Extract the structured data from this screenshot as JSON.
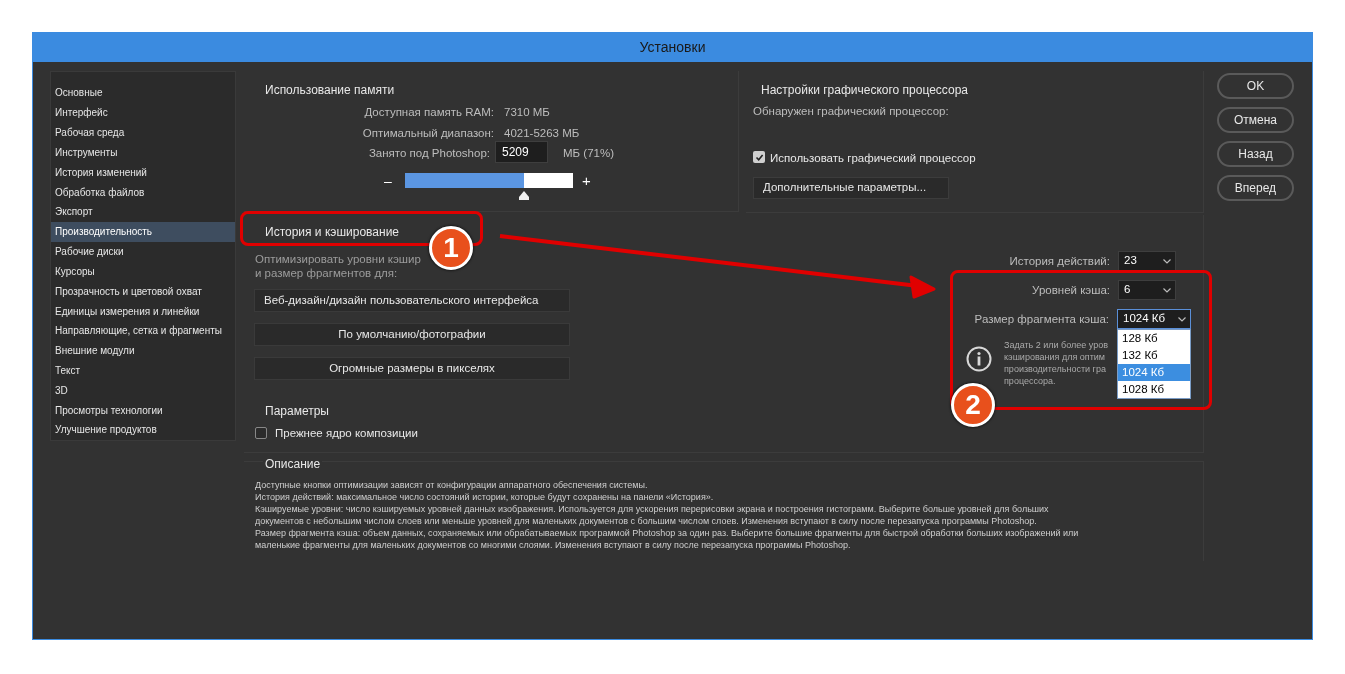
{
  "window": {
    "title": "Установки"
  },
  "sidebar": {
    "items": [
      {
        "label": "Основные",
        "selected": false
      },
      {
        "label": "Интерфейс",
        "selected": false
      },
      {
        "label": "Рабочая среда",
        "selected": false
      },
      {
        "label": "Инструменты",
        "selected": false
      },
      {
        "label": "История изменений",
        "selected": false
      },
      {
        "label": "Обработка файлов",
        "selected": false
      },
      {
        "label": "Экспорт",
        "selected": false
      },
      {
        "label": "Производительность",
        "selected": true
      },
      {
        "label": "Рабочие диски",
        "selected": false
      },
      {
        "label": "Курсоры",
        "selected": false
      },
      {
        "label": "Прозрачность и цветовой охват",
        "selected": false
      },
      {
        "label": "Единицы измерения и линейки",
        "selected": false
      },
      {
        "label": "Направляющие, сетка и фрагменты",
        "selected": false
      },
      {
        "label": "Внешние модули",
        "selected": false
      },
      {
        "label": "Текст",
        "selected": false
      },
      {
        "label": "3D",
        "selected": false
      },
      {
        "label": "Просмотры технологии",
        "selected": false
      },
      {
        "label": "Улучшение продуктов",
        "selected": false
      }
    ]
  },
  "memory": {
    "title": "Использование памяти",
    "rows": [
      {
        "label": "Доступная память RAM:",
        "value": "7310 МБ"
      },
      {
        "label": "Оптимальный диапазон:",
        "value": "4021-5263 МБ"
      }
    ],
    "field": {
      "label": "Занято под Photoshop:",
      "value": "5209",
      "unit": "МБ (71%)"
    },
    "slider": {
      "minus": "–",
      "plus": "+",
      "level": 0.71
    }
  },
  "gpu": {
    "title": "Настройки графического процессора",
    "detected": "Обнаружен графический процессор:",
    "use_gpu": {
      "label": "Использовать графический процессор",
      "checked": true
    },
    "advanced_button": "Дополнительные параметры..."
  },
  "history": {
    "title": "История и кэширование",
    "optimize_lines": [
      "Оптимизировать уровни кэшир",
      "и размер фрагментов для:"
    ],
    "presets": [
      "Веб-дизайн/дизайн пользовательского интерфейса",
      "По умолчанию/фотографии",
      "Огромные размеры в пикселях"
    ],
    "params_title": "Параметры",
    "legacy": {
      "label": "Прежнее ядро композиции",
      "checked": false
    },
    "selects": [
      {
        "label": "История действий:",
        "value": "23",
        "open": false
      },
      {
        "label": "Уровней кэша:",
        "value": "6",
        "open": false
      },
      {
        "label": "Размер фрагмента кэша:",
        "value": "1024 Кб",
        "open": true
      }
    ],
    "options": [
      {
        "label": "128 Кб",
        "selected": false
      },
      {
        "label": "132 Кб",
        "selected": false
      },
      {
        "label": "1024 Кб",
        "selected": true
      },
      {
        "label": "1028 Кб",
        "selected": false
      }
    ],
    "info_lines": [
      "Задать 2 или более уров",
      "кэширования для оптим",
      "производительности гра",
      "процессора."
    ]
  },
  "description": {
    "title": "Описание",
    "lines": [
      "Доступные кнопки оптимизации зависят от конфигурации аппаратного обеспечения системы.",
      "История действий: максимальное число состояний истории, которые будут сохранены на панели «История».",
      "Кэшируемые уровни: число кэшируемых уровней данных изображения. Используется для ускорения перерисовки экрана и построения гистограмм. Выберите больше уровней для больших",
      "документов с небольшим числом слоев или меньше уровней для маленьких документов с большим числом слоев. Изменения вступают в силу после перезапуска программы Photoshop.",
      "Размер фрагмента кэша: объем данных, сохраняемых или обрабатываемых программой Photoshop за один раз. Выберите большие фрагменты для быстрой обработки больших изображений или",
      "маленькие фрагменты для маленьких документов со многими слоями. Изменения вступают в силу после перезапуска программы Photoshop."
    ]
  },
  "buttons": [
    "OK",
    "Отмена",
    "Назад",
    "Вперед"
  ],
  "annotations": [
    {
      "kind": "highlight"
    },
    {
      "kind": "badge",
      "label": "1"
    },
    {
      "kind": "arrow"
    },
    {
      "kind": "highlight"
    },
    {
      "kind": "badge",
      "label": "2"
    }
  ]
}
